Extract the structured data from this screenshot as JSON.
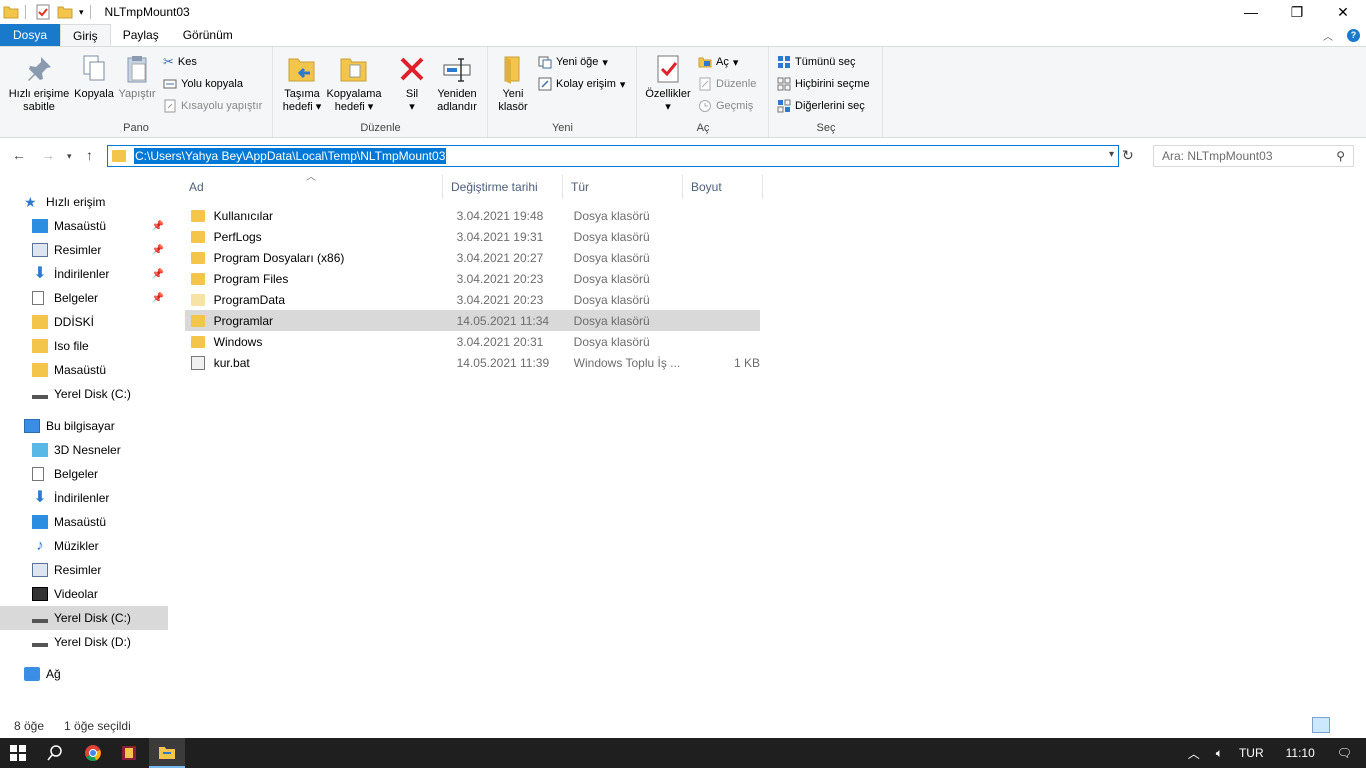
{
  "window": {
    "title": "NLTmpMount03",
    "minimize": "—",
    "restore": "❐",
    "close": "✕"
  },
  "tabs": [
    {
      "label": "Dosya"
    },
    {
      "label": "Giriş"
    },
    {
      "label": "Paylaş"
    },
    {
      "label": "Görünüm"
    }
  ],
  "ribbon": {
    "pano": {
      "label": "Pano",
      "pin": "Hızlı erişime sabitle",
      "pin_l1": "Hızlı erişime",
      "pin_l2": "sabitle",
      "copy": "Kopyala",
      "paste": "Yapıştır",
      "cut": "Kes",
      "copy_path": "Yolu kopyala",
      "paste_shortcut": "Kısayolu yapıştır"
    },
    "duzenle": {
      "label": "Düzenle",
      "move_l1": "Taşıma",
      "move_l2": "hedefi",
      "copyto_l1": "Kopyalama",
      "copyto_l2": "hedefi",
      "delete": "Sil",
      "rename_l1": "Yeniden",
      "rename_l2": "adlandır"
    },
    "yeni": {
      "label": "Yeni",
      "new_folder_l1": "Yeni",
      "new_folder_l2": "klasör",
      "new_item": "Yeni öğe",
      "easy_access": "Kolay erişim"
    },
    "ac": {
      "label": "Aç",
      "properties": "Özellikler",
      "open": "Aç",
      "edit": "Düzenle",
      "history": "Geçmiş"
    },
    "sec": {
      "label": "Seç",
      "select_all": "Tümünü seç",
      "select_none": "Hiçbirini seçme",
      "invert": "Diğerlerini seç"
    }
  },
  "address": {
    "path": "C:\\Users\\Yahya Bey\\AppData\\Local\\Temp\\NLTmpMount03",
    "search_placeholder": "Ara: NLTmpMount03"
  },
  "navpane": {
    "quick_access": "Hızlı erişim",
    "quick_items": [
      {
        "label": "Masaüstü",
        "pinned": true
      },
      {
        "label": "Resimler",
        "pinned": true
      },
      {
        "label": "İndirilenler",
        "pinned": true
      },
      {
        "label": "Belgeler",
        "pinned": true
      },
      {
        "label": "DDİSKİ",
        "pinned": false
      },
      {
        "label": "Iso file",
        "pinned": false
      },
      {
        "label": "Masaüstü",
        "pinned": false
      },
      {
        "label": "Yerel Disk (C:)",
        "pinned": false
      }
    ],
    "this_pc": "Bu bilgisayar",
    "pc_items": [
      {
        "label": "3D Nesneler"
      },
      {
        "label": "Belgeler"
      },
      {
        "label": "İndirilenler"
      },
      {
        "label": "Masaüstü"
      },
      {
        "label": "Müzikler"
      },
      {
        "label": "Resimler"
      },
      {
        "label": "Videolar"
      },
      {
        "label": "Yerel Disk (C:)"
      },
      {
        "label": "Yerel Disk (D:)"
      }
    ],
    "network": "Ağ"
  },
  "columns": {
    "name": "Ad",
    "date": "Değiştirme tarihi",
    "type": "Tür",
    "size": "Boyut"
  },
  "files": [
    {
      "name": "Kullanıcılar",
      "date": "3.04.2021 19:48",
      "type": "Dosya klasörü",
      "size": ""
    },
    {
      "name": "PerfLogs",
      "date": "3.04.2021 19:31",
      "type": "Dosya klasörü",
      "size": ""
    },
    {
      "name": "Program Dosyaları (x86)",
      "date": "3.04.2021 20:27",
      "type": "Dosya klasörü",
      "size": ""
    },
    {
      "name": "Program Files",
      "date": "3.04.2021 20:23",
      "type": "Dosya klasörü",
      "size": ""
    },
    {
      "name": "ProgramData",
      "date": "3.04.2021 20:23",
      "type": "Dosya klasörü",
      "size": ""
    },
    {
      "name": "Programlar",
      "date": "14.05.2021 11:34",
      "type": "Dosya klasörü",
      "size": ""
    },
    {
      "name": "Windows",
      "date": "3.04.2021 20:31",
      "type": "Dosya klasörü",
      "size": ""
    },
    {
      "name": "kur.bat",
      "date": "14.05.2021 11:39",
      "type": "Windows Toplu İş ...",
      "size": "1 KB"
    }
  ],
  "status": {
    "count": "8 öğe",
    "selected": "1 öğe seçildi"
  },
  "taskbar": {
    "lang": "TUR",
    "time": "11:10"
  },
  "colors": {
    "accent": "#0078d7",
    "file_tab": "#1979ca",
    "folder": "#f3c54b",
    "selection": "#d9d9d9"
  }
}
